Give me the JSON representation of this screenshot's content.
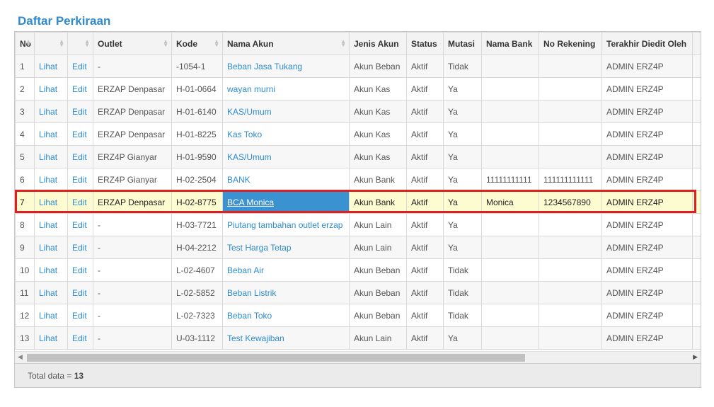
{
  "page_title": "Daftar Perkiraan",
  "columns": [
    "No",
    "",
    "",
    "Outlet",
    "Kode",
    "Nama Akun",
    "Jenis Akun",
    "Status",
    "Mutasi",
    "Nama Bank",
    "No Rekening",
    "Terakhir Diedit Oleh"
  ],
  "view_label": "Lihat",
  "edit_label": "Edit",
  "rows": [
    {
      "no": "1",
      "outlet": "-",
      "kode": "-1054-1",
      "nama": "Beban Jasa Tukang",
      "jenis": "Akun Beban",
      "status": "Aktif",
      "mutasi": "Tidak",
      "bank": "",
      "rek": "",
      "editor": "ADMIN ERZ4P"
    },
    {
      "no": "2",
      "outlet": "ERZAP Denpasar",
      "kode": "H-01-0664",
      "nama": "wayan murni",
      "jenis": "Akun Kas",
      "status": "Aktif",
      "mutasi": "Ya",
      "bank": "",
      "rek": "",
      "editor": "ADMIN ERZ4P"
    },
    {
      "no": "3",
      "outlet": "ERZAP Denpasar",
      "kode": "H-01-6140",
      "nama": "KAS/Umum",
      "jenis": "Akun Kas",
      "status": "Aktif",
      "mutasi": "Ya",
      "bank": "",
      "rek": "",
      "editor": "ADMIN ERZ4P"
    },
    {
      "no": "4",
      "outlet": "ERZAP Denpasar",
      "kode": "H-01-8225",
      "nama": "Kas Toko",
      "jenis": "Akun Kas",
      "status": "Aktif",
      "mutasi": "Ya",
      "bank": "",
      "rek": "",
      "editor": "ADMIN ERZ4P"
    },
    {
      "no": "5",
      "outlet": "ERZ4P Gianyar",
      "kode": "H-01-9590",
      "nama": "KAS/Umum",
      "jenis": "Akun Kas",
      "status": "Aktif",
      "mutasi": "Ya",
      "bank": "",
      "rek": "",
      "editor": "ADMIN ERZ4P"
    },
    {
      "no": "6",
      "outlet": "ERZ4P Gianyar",
      "kode": "H-02-2504",
      "nama": "BANK",
      "jenis": "Akun Bank",
      "status": "Aktif",
      "mutasi": "Ya",
      "bank": "11111111111",
      "rek": "111111111111",
      "editor": "ADMIN ERZ4P"
    },
    {
      "no": "7",
      "outlet": "ERZAP Denpasar",
      "kode": "H-02-8775",
      "nama": "BCA Monica",
      "jenis": "Akun Bank",
      "status": "Aktif",
      "mutasi": "Ya",
      "bank": "Monica",
      "rek": "1234567890",
      "editor": "ADMIN ERZ4P",
      "selected": true
    },
    {
      "no": "8",
      "outlet": "-",
      "kode": "H-03-7721",
      "nama": "Piutang tambahan outlet erzap",
      "jenis": "Akun Lain",
      "status": "Aktif",
      "mutasi": "Ya",
      "bank": "",
      "rek": "",
      "editor": "ADMIN ERZ4P"
    },
    {
      "no": "9",
      "outlet": "-",
      "kode": "H-04-2212",
      "nama": "Test Harga Tetap",
      "jenis": "Akun Lain",
      "status": "Aktif",
      "mutasi": "Ya",
      "bank": "",
      "rek": "",
      "editor": "ADMIN ERZ4P"
    },
    {
      "no": "10",
      "outlet": "-",
      "kode": "L-02-4607",
      "nama": "Beban Air",
      "jenis": "Akun Beban",
      "status": "Aktif",
      "mutasi": "Tidak",
      "bank": "",
      "rek": "",
      "editor": "ADMIN ERZ4P"
    },
    {
      "no": "11",
      "outlet": "-",
      "kode": "L-02-5852",
      "nama": "Beban Listrik",
      "jenis": "Akun Beban",
      "status": "Aktif",
      "mutasi": "Tidak",
      "bank": "",
      "rek": "",
      "editor": "ADMIN ERZ4P"
    },
    {
      "no": "12",
      "outlet": "-",
      "kode": "L-02-7323",
      "nama": "Beban Toko",
      "jenis": "Akun Beban",
      "status": "Aktif",
      "mutasi": "Tidak",
      "bank": "",
      "rek": "",
      "editor": "ADMIN ERZ4P"
    },
    {
      "no": "13",
      "outlet": "-",
      "kode": "U-03-1112",
      "nama": "Test Kewajiban",
      "jenis": "Akun Lain",
      "status": "Aktif",
      "mutasi": "Ya",
      "bank": "",
      "rek": "",
      "editor": "ADMIN ERZ4P"
    }
  ],
  "footer": {
    "label": "Total data = ",
    "count": "13"
  },
  "colors": {
    "link": "#2e8bcd",
    "highlight_border": "#e02020",
    "selected_row": "#fdfbd0",
    "selected_cell": "#3b92d0"
  }
}
